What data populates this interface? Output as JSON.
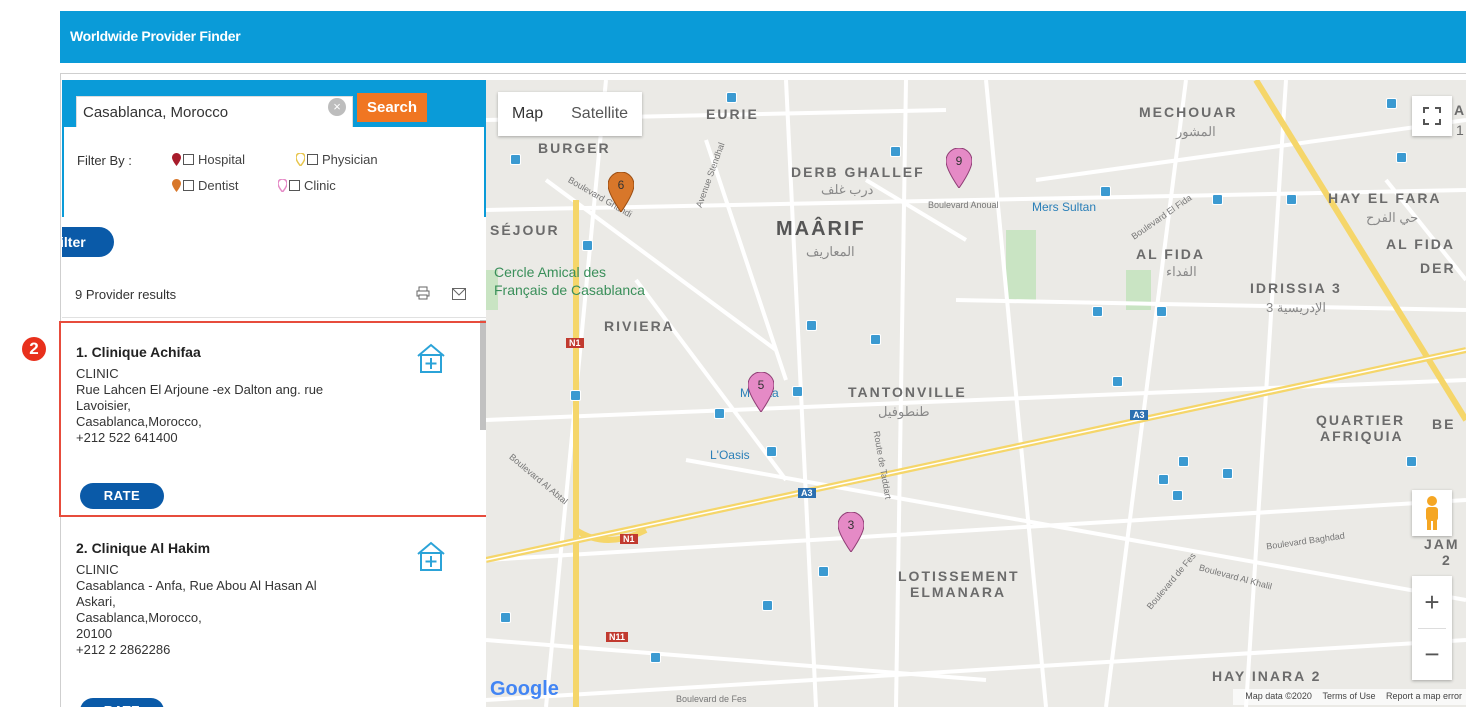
{
  "header": {
    "title": "Worldwide Provider Finder"
  },
  "search": {
    "value": "Casablanca, Morocco",
    "button_label": "Search",
    "clear_icon": "clear-icon"
  },
  "filter": {
    "label": "Filter By :",
    "options": [
      {
        "label": "Hospital",
        "pin_color": "#a81c2b"
      },
      {
        "label": "Physician",
        "pin_color": "#e8c64d"
      },
      {
        "label": "Dentist",
        "pin_color": "#d8772a"
      },
      {
        "label": "Clinic",
        "pin_color": "#e58ac6"
      }
    ],
    "apply_button": "ilter"
  },
  "results": {
    "count_text": "9 Provider results",
    "items": [
      {
        "name": "1. Clinique Achifaa",
        "type": "CLINIC",
        "address_1": "Rue Lahcen El Arjoune -ex Dalton ang. rue",
        "address_2": "Lavoisier,",
        "city": "Casablanca,Morocco,",
        "phone": "+212 522 641400",
        "rate_label": "RATE"
      },
      {
        "name": "2. Clinique Al Hakim",
        "type": "CLINIC",
        "address_1": "Casablanca - Anfa, Rue Abou Al Hasan Al",
        "address_2": "Askari,",
        "city": "Casablanca,Morocco,",
        "postal": "20100",
        "phone": "+212 2 2862286",
        "rate_label": "RATE"
      }
    ]
  },
  "step_badge": "2",
  "map": {
    "type_map": "Map",
    "type_satellite": "Satellite",
    "zoom_in": "+",
    "zoom_out": "−",
    "labels": {
      "burger": "BURGER",
      "eurie": "EURIE",
      "sejour": "SÉJOUR",
      "derb_ghallef": "DERB GHALLEF",
      "derb_ghallef_ar": "درب غلف",
      "maarif": "MAÂRIF",
      "maarif_ar": "المعاريف",
      "mechouar": "MECHOUAR",
      "mechouar_ar": "المشور",
      "hay_el_fara": "HAY EL FARA",
      "hay_el_fara_ar": "حي الفرح",
      "al_fida": "AL FIDA",
      "al_fida_ar": "الفداء",
      "al_fida_2": "AL FIDA",
      "der": "DER",
      "idrissia": "IDRISSIA 3",
      "idrissia_ar": "الإدريسية 3",
      "riviera": "RIVIERA",
      "cercle_1": "Cercle Amical des",
      "cercle_2": "Français de Casablanca",
      "mers_sultan": "Mers Sultan",
      "tantonville": "TANTONVILLE",
      "tantonville_ar": "طنطوفيل",
      "quartier": "QUARTIER",
      "afriquia": "AFRIQUIA",
      "be": "BE",
      "loasis": "L'Oasis",
      "maka": "Mʼ",
      "maka_2": "ka",
      "lotissement": "LOTISSEMENT",
      "elmanara": "ELMANARA",
      "jam": "JAM",
      "jam_2": "2",
      "hay_inara": "HAY INARA 2",
      "blvd_ghandi": "Boulevard Ghandi",
      "ave_stendhal": "Avenue Stendhal",
      "blvd_anoual": "Boulevard Anoual",
      "blvd_el_fida": "Boulevard El Fida",
      "blvd_al_abtal": "Boulevard Al Abtal",
      "route_taddart": "Route de Taddart",
      "blvd_fes": "Boulevard de Fes",
      "blvd_baghdad": "Boulevard Baghdad",
      "blvd_al_khalil": "Boulevard Al Khalil",
      "blvd_fes_2": "Boulevard de Fes",
      "a3": "A3",
      "a3_2": "A3",
      "n1": "N1",
      "n1_2": "N1",
      "n11": "N11"
    },
    "pins": [
      {
        "number": "6",
        "color": "#d8772a"
      },
      {
        "number": "9",
        "color": "#e58ac6"
      },
      {
        "number": "5",
        "color": "#e58ac6"
      },
      {
        "number": "3",
        "color": "#e58ac6"
      }
    ],
    "google": "Google",
    "footer": {
      "data": "Map data ©2020",
      "terms": "Terms of Use",
      "report": "Report a map error"
    },
    "corner_a": "A",
    "corner_1": "1"
  },
  "colors": {
    "header_bg": "#0a9bd8",
    "search_btn": "#f07622",
    "primary_btn": "#0a5aa8",
    "highlight": "#e74c3c"
  }
}
